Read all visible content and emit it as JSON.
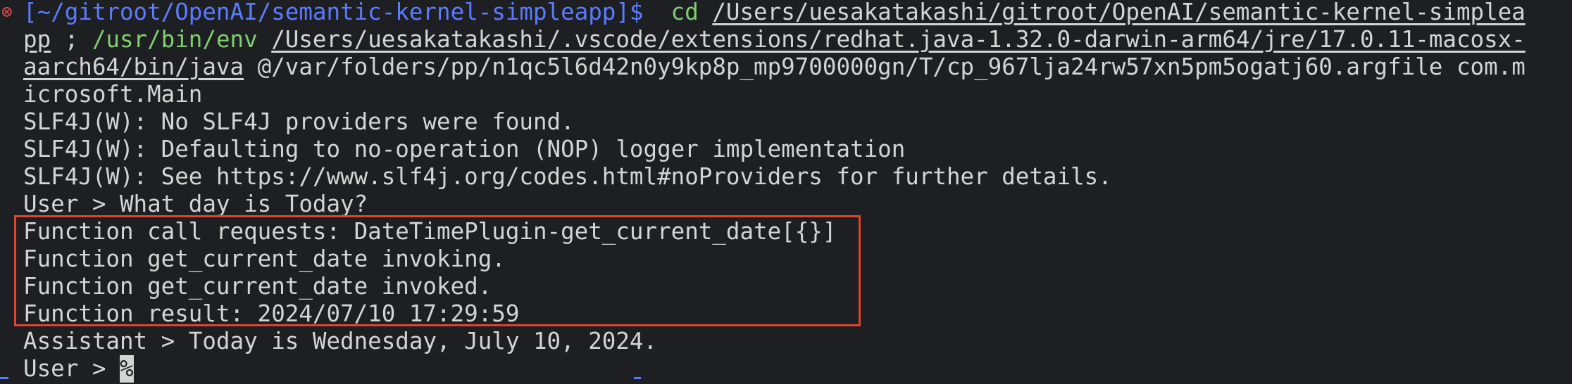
{
  "terminal": {
    "line1": {
      "prompt": "[~/gitroot/OpenAI/semantic-kernel-simpleapp]$",
      "cmd": "cd",
      "path": "/Users/uesakatakashi/gitroot/OpenAI/semantic-kernel-simplea"
    },
    "line2": {
      "cont": "pp",
      "sep": " ; ",
      "env": "/usr/bin/env",
      "java": "/Users/uesakatakashi/.vscode/extensions/redhat.java-1.32.0-darwin-arm64/jre/17.0.11-macosx-"
    },
    "line3": {
      "java_cont": "aarch64/bin/java",
      "args": " @/var/folders/pp/n1qc5l6d42n0y9kp8p_mp9700000gn/T/cp_967lja24rw57xn5pm5ogatj60.argfile com.m"
    },
    "line4": "icrosoft.Main",
    "line5": "SLF4J(W): No SLF4J providers were found.",
    "line6": "SLF4J(W): Defaulting to no-operation (NOP) logger implementation",
    "line7": "SLF4J(W): See https://www.slf4j.org/codes.html#noProviders for further details.",
    "line8": "User > What day is Today?",
    "line9": "Function call requests: DateTimePlugin-get_current_date[{}]",
    "line10": "Function get_current_date invoking.",
    "line11": "Function get_current_date invoked.",
    "line12": "Function result: 2024/07/10 17:29:59",
    "line13": "Assistant > Today is Wednesday, July 10, 2024.",
    "line14": "User > ",
    "cursor": "%"
  },
  "colors": {
    "background": "#1e1f22",
    "prompt": "#5b7cff",
    "command": "#7fcf6e",
    "error_icon": "#e24c4c",
    "highlight_box": "#e0432e"
  },
  "icons": {
    "error": "error-circle-icon"
  }
}
